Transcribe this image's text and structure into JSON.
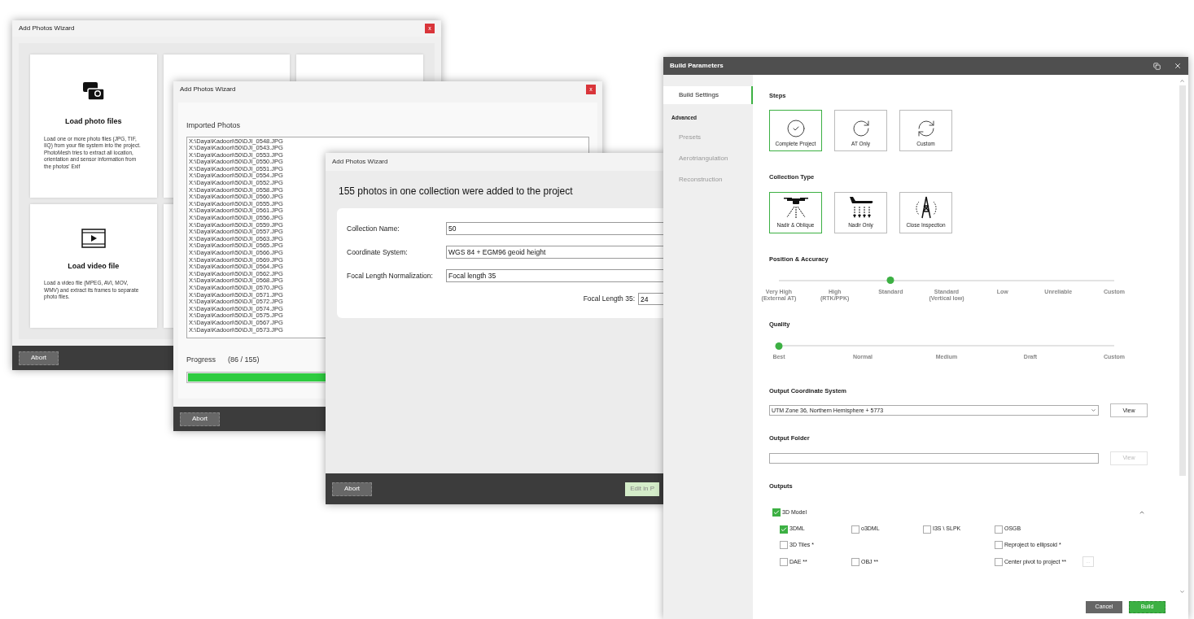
{
  "photo_source_wizard": {
    "title": "Add Photos Wizard",
    "close": "x",
    "cards": [
      {
        "kind": "photos",
        "heading": "Load photo files",
        "description": "Load one or more photo files (JPG, TIF, IIQ) from your file system into the project. PhotoMesh tries to extract all location, orientation and sensor information from the photos' Exif"
      },
      {
        "kind": "blank"
      },
      {
        "kind": "blank"
      },
      {
        "kind": "video",
        "heading": "Load video file",
        "description": "Load a video file (MPEG, AVI, MOV, WMV) and extract its frames to separate photo files."
      },
      {
        "kind": "blank"
      }
    ],
    "abort": "Abort"
  },
  "import_wizard": {
    "title": "Add Photos Wizard",
    "close": "x",
    "list_title": "Imported Photos",
    "files": [
      "X:\\Daya\\Kadoori\\50\\DJI_0548.JPG",
      "X:\\Daya\\Kadoori\\50\\DJI_0543.JPG",
      "X:\\Daya\\Kadoori\\50\\DJI_0553.JPG",
      "X:\\Daya\\Kadoori\\50\\DJI_0550.JPG",
      "X:\\Daya\\Kadoori\\50\\DJI_0551.JPG",
      "X:\\Daya\\Kadoori\\50\\DJI_0554.JPG",
      "X:\\Daya\\Kadoori\\50\\DJI_0552.JPG",
      "X:\\Daya\\Kadoori\\50\\DJI_0558.JPG",
      "X:\\Daya\\Kadoori\\50\\DJI_0560.JPG",
      "X:\\Daya\\Kadoori\\50\\DJI_0555.JPG",
      "X:\\Daya\\Kadoori\\50\\DJI_0561.JPG",
      "X:\\Daya\\Kadoori\\50\\DJI_0556.JPG",
      "X:\\Daya\\Kadoori\\50\\DJI_0559.JPG",
      "X:\\Daya\\Kadoori\\50\\DJI_0557.JPG",
      "X:\\Daya\\Kadoori\\50\\DJI_0563.JPG",
      "X:\\Daya\\Kadoori\\50\\DJI_0565.JPG",
      "X:\\Daya\\Kadoori\\50\\DJI_0566.JPG",
      "X:\\Daya\\Kadoori\\50\\DJI_0569.JPG",
      "X:\\Daya\\Kadoori\\50\\DJI_0564.JPG",
      "X:\\Daya\\Kadoori\\50\\DJI_0562.JPG",
      "X:\\Daya\\Kadoori\\50\\DJI_0568.JPG",
      "X:\\Daya\\Kadoori\\50\\DJI_0570.JPG",
      "X:\\Daya\\Kadoori\\50\\DJI_0571.JPG",
      "X:\\Daya\\Kadoori\\50\\DJI_0572.JPG",
      "X:\\Daya\\Kadoori\\50\\DJI_0574.JPG",
      "X:\\Daya\\Kadoori\\50\\DJI_0575.JPG",
      "X:\\Daya\\Kadoori\\50\\DJI_0567.JPG",
      "X:\\Daya\\Kadoori\\50\\DJI_0573.JPG"
    ],
    "progress_label": "Progress",
    "progress_count": "(86 / 155)",
    "level": 0.555,
    "abort": "Abort"
  },
  "collection_wizard": {
    "title": "Add Photos Wizard",
    "heading": "155 photos in one collection were added to the project",
    "fields": [
      {
        "label": "Collection Name:",
        "value": "50"
      },
      {
        "label": "Coordinate System:",
        "value": "WGS 84 + EGM96 geoid height"
      },
      {
        "label": "Focal Length Normalization:",
        "value": "Focal length 35"
      }
    ],
    "focal_length": {
      "label": "Focal Length 35:",
      "value": "24"
    },
    "abort": "Abort",
    "edit_button": "Edit in P"
  },
  "build_parameters": {
    "title": "Build Parameters",
    "sidebar": [
      {
        "kind": "item",
        "label": "Build Settings",
        "selected": true
      },
      {
        "kind": "header",
        "label": "Advanced"
      },
      {
        "kind": "item",
        "label": "Presets",
        "selected": false
      },
      {
        "kind": "item",
        "label": "Aerotriangulation",
        "selected": false
      },
      {
        "kind": "item",
        "label": "Reconstruction",
        "selected": false
      }
    ],
    "steps": {
      "heading": "Steps",
      "options": [
        {
          "kind": "check",
          "label": "Complete Project",
          "selected": true
        },
        {
          "kind": "at",
          "label": "AT Only",
          "selected": false
        },
        {
          "kind": "custom",
          "label": "Custom",
          "selected": false
        }
      ]
    },
    "collection_type": {
      "heading": "Collection Type",
      "options": [
        {
          "kind": "oblique",
          "label": "Nadir & Oblique",
          "selected": true
        },
        {
          "kind": "nadir",
          "label": "Nadir Only",
          "selected": false
        },
        {
          "kind": "inspection",
          "label": "Close Inspection",
          "selected": false
        }
      ]
    },
    "position_accuracy": {
      "heading": "Position & Accuracy",
      "level": 0.3333,
      "stops": [
        "Very High\n(External AT)",
        "High\n(RTK/PPK)",
        "Standard",
        "Standard\n(Vertical low)",
        "Low",
        "Unreliable",
        "Custom"
      ]
    },
    "quality": {
      "heading": "Quality",
      "level": 0,
      "stops": [
        "Best",
        "Normal",
        "Medium",
        "Draft",
        "Custom"
      ]
    },
    "output_coordinate_system": {
      "heading": "Output Coordinate System",
      "value": "UTM Zone 36, Northern Hemisphere + 5773",
      "view": "View",
      "view_disabled": false
    },
    "output_folder": {
      "heading": "Output Folder",
      "view": "View",
      "view_disabled": true
    },
    "outputs": {
      "heading": "Outputs",
      "model": {
        "label": "3D Model",
        "checked": true,
        "expanded": true
      },
      "rows": [
        [
          {
            "kind": "checkbox",
            "label": "3DML",
            "checked": true
          },
          {
            "kind": "checkbox",
            "label": "o3DML",
            "checked": false
          },
          {
            "kind": "checkbox",
            "label": "I3S \\ SLPK",
            "checked": false
          },
          {
            "kind": "checkbox",
            "label": "OSGB",
            "checked": false
          }
        ],
        [
          {
            "kind": "checkbox",
            "label": "3D Tiles *",
            "checked": false
          },
          {
            "kind": "blank"
          },
          {
            "kind": "blank"
          },
          {
            "kind": "checkbox",
            "label": "Reproject to ellipsoid *",
            "checked": false
          }
        ],
        [
          {
            "kind": "checkbox",
            "label": "DAE **",
            "checked": false
          },
          {
            "kind": "checkbox",
            "label": "OBJ **",
            "checked": false
          },
          {
            "kind": "blank"
          },
          {
            "kind": "checkbox_more",
            "label": "Center pivot to project **",
            "checked": false,
            "more": "..."
          }
        ]
      ]
    },
    "cancel": "Cancel",
    "build": "Build"
  }
}
